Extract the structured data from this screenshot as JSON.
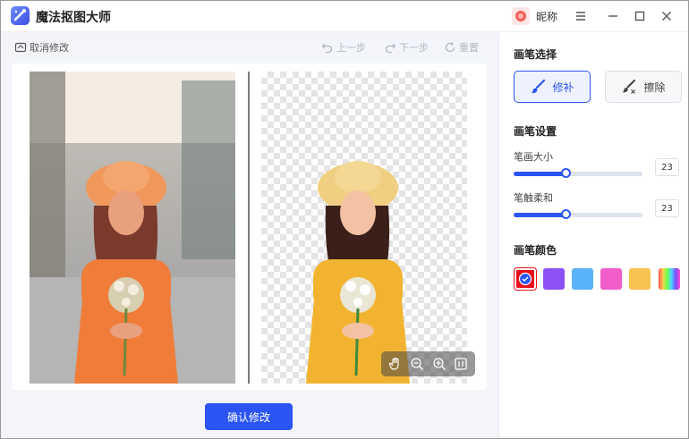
{
  "app": {
    "title": "魔法抠图大师",
    "user_name": "昵称"
  },
  "toolbar": {
    "cancel": "取消修改",
    "undo": "上一步",
    "redo": "下一步",
    "reset": "重置"
  },
  "confirm_label": "确认修改",
  "panel": {
    "brush_select_title": "画笔选择",
    "brush_repair": "修补",
    "brush_erase": "擦除",
    "brush_settings_title": "画笔设置",
    "size_label": "笔画大小",
    "size_value": "23",
    "size_fraction": 0.41,
    "softness_label": "笔触柔和",
    "softness_value": "23",
    "softness_fraction": 0.41,
    "color_title": "画笔颜色",
    "colors": [
      "#e8101a",
      "#8c52f5",
      "#5ab2fb",
      "#f25ec9",
      "#f7c24f",
      "rainbow"
    ],
    "selected_color_index": 0
  },
  "icons": [
    "app-logo-icon",
    "menu-icon",
    "minimize-icon",
    "maximize-icon",
    "close-icon",
    "home-icon",
    "undo-icon",
    "redo-icon",
    "reset-icon",
    "hand-icon",
    "zoom-out-icon",
    "zoom-in-icon",
    "fit-icon",
    "brush-icon",
    "eraser-icon",
    "check-icon"
  ]
}
